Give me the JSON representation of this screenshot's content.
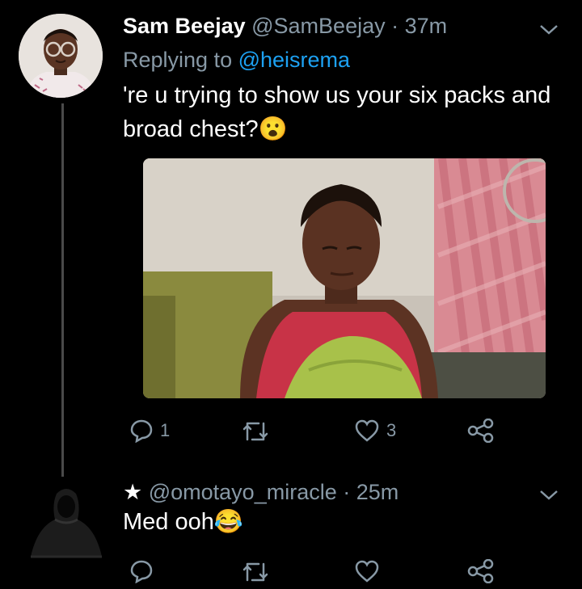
{
  "tweets": [
    {
      "display_name": "Sam Beejay",
      "handle": "@SamBeejay",
      "separator": "·",
      "time": "37m",
      "replying_prefix": "Replying to",
      "replying_to": "@heisrema",
      "text": "'re u trying to show us your six packs and broad chest?",
      "emoji": "😮",
      "actions": {
        "replies": "1",
        "retweets": "",
        "likes": "3"
      }
    },
    {
      "star": "★",
      "handle": "@omotayo_miracle",
      "separator": "·",
      "time": "25m",
      "text": "Med ooh",
      "emoji": "😂",
      "actions": {
        "replies": "",
        "retweets": "",
        "likes": ""
      }
    }
  ],
  "colors": {
    "background": "#000000",
    "text": "#ffffff",
    "muted": "#8899a6",
    "link": "#1da1f2",
    "thread_line": "#4a4a4a"
  },
  "icons": [
    "reply-icon",
    "retweet-icon",
    "like-icon",
    "share-icon",
    "chevron-down-icon"
  ]
}
